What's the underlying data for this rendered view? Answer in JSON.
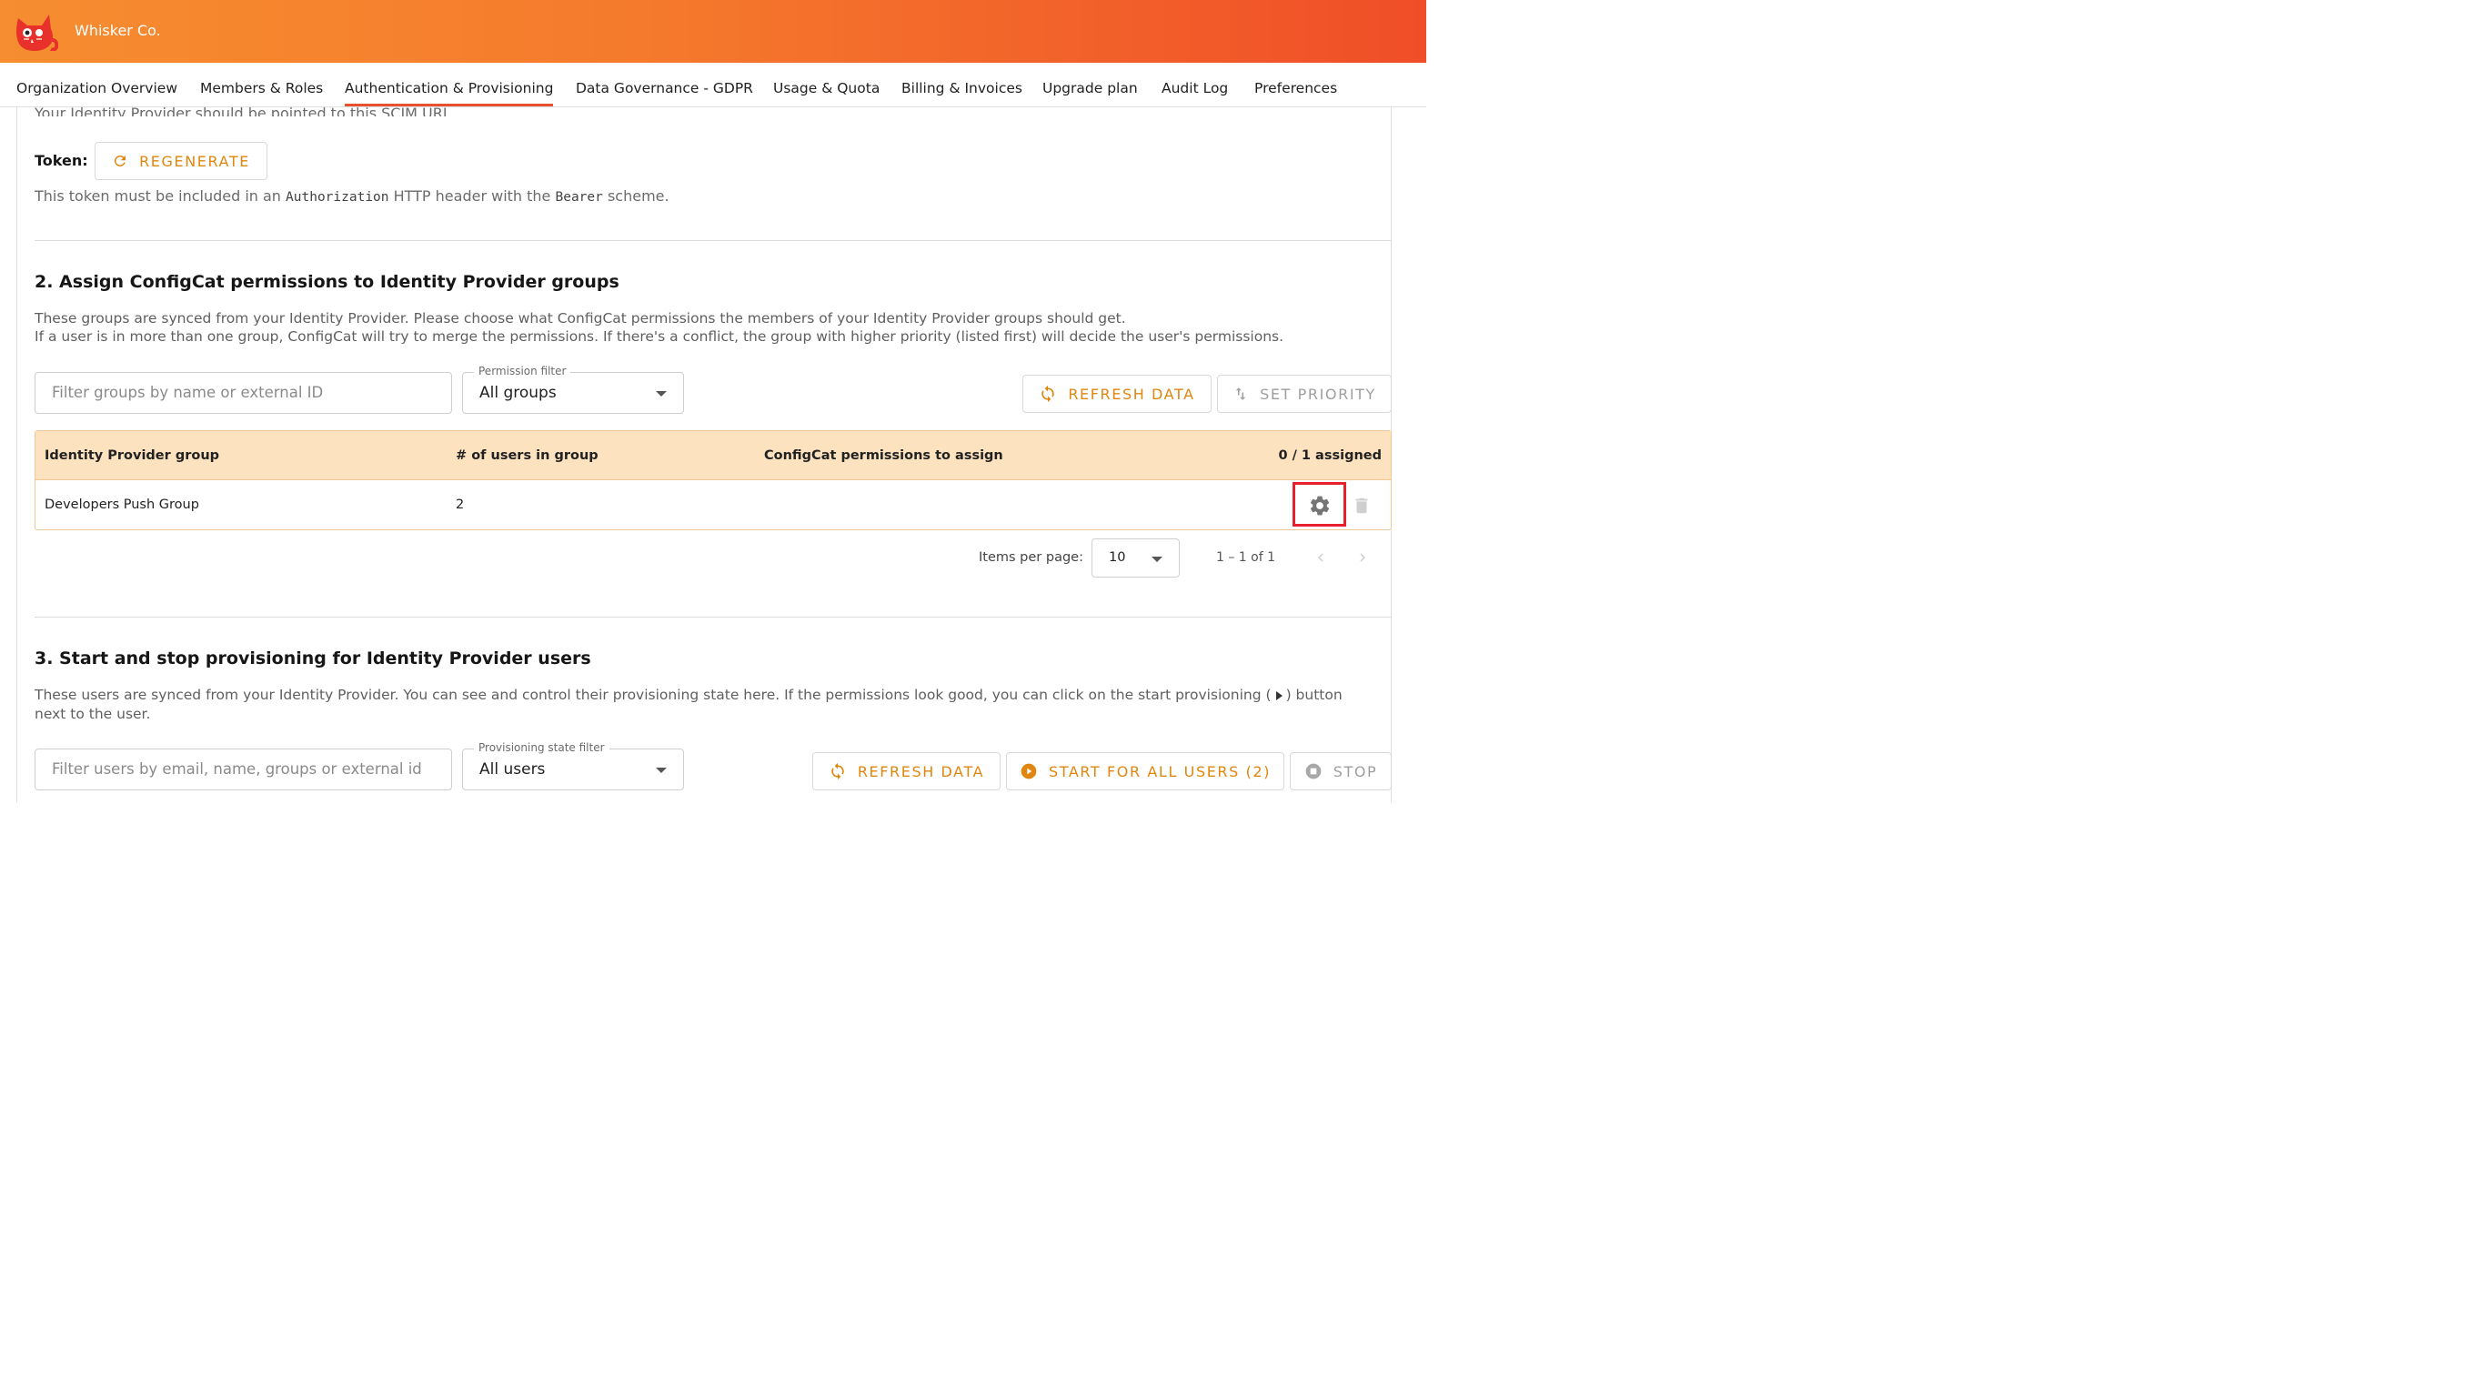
{
  "app": {
    "org_name": "Whisker Co."
  },
  "tabs": [
    {
      "label": "Organization Overview"
    },
    {
      "label": "Members & Roles"
    },
    {
      "label": "Authentication & Provisioning"
    },
    {
      "label": "Data Governance - GDPR"
    },
    {
      "label": "Usage & Quota"
    },
    {
      "label": "Billing & Invoices"
    },
    {
      "label": "Upgrade plan"
    },
    {
      "label": "Audit Log"
    },
    {
      "label": "Preferences"
    }
  ],
  "active_tab": "Authentication & Provisioning",
  "scim": {
    "url_hint": "Your Identity Provider should be pointed to this SCIM URL.",
    "token_label": "Token:",
    "regenerate_label": "REGENERATE",
    "token_note_pre": "This token must be included in an ",
    "token_note_code1": "Authorization",
    "token_note_mid": " HTTP header with the ",
    "token_note_code2": "Bearer",
    "token_note_post": " scheme."
  },
  "section2": {
    "title": "2. Assign ConfigCat permissions to Identity Provider groups",
    "desc_line1": "These groups are synced from your Identity Provider. Please choose what ConfigCat permissions the members of your Identity Provider groups should get.",
    "desc_line2": "If a user is in more than one group, ConfigCat will try to merge the permissions. If there's a conflict, the group with higher priority (listed first) will decide the user's permissions.",
    "filter_placeholder": "Filter groups by name or external ID",
    "permission_filter_label": "Permission filter",
    "permission_filter_value": "All groups",
    "refresh_label": "REFRESH DATA",
    "set_priority_label": "SET PRIORITY",
    "table": {
      "headers": [
        "Identity Provider group",
        "# of users in group",
        "ConfigCat permissions to assign",
        "0 / 1 assigned"
      ],
      "rows": [
        {
          "group": "Developers Push Group",
          "users": "2",
          "permissions": ""
        }
      ]
    },
    "paginator": {
      "items_per_page_label": "Items per page:",
      "page_size": "10",
      "range": "1 – 1 of 1"
    }
  },
  "section3": {
    "title": "3. Start and stop provisioning for Identity Provider users",
    "desc_line1_pre": "These users are synced from your Identity Provider. You can see and control their provisioning state here. If the permissions look good, you can click on the start provisioning (",
    "desc_line1_post": ") button",
    "desc_line2": "next to the user.",
    "filter_placeholder": "Filter users by email, name, groups or external id",
    "state_filter_label": "Provisioning state filter",
    "state_filter_value": "All users",
    "refresh_label": "REFRESH DATA",
    "start_all_label": "START FOR ALL USERS (2)",
    "stop_label": "STOP"
  },
  "colors": {
    "accent": "#e0860e",
    "header_start": "#f68d30",
    "header_end": "#f04e28",
    "table_header_bg": "#fde2bf",
    "highlight": "#e8202b"
  }
}
